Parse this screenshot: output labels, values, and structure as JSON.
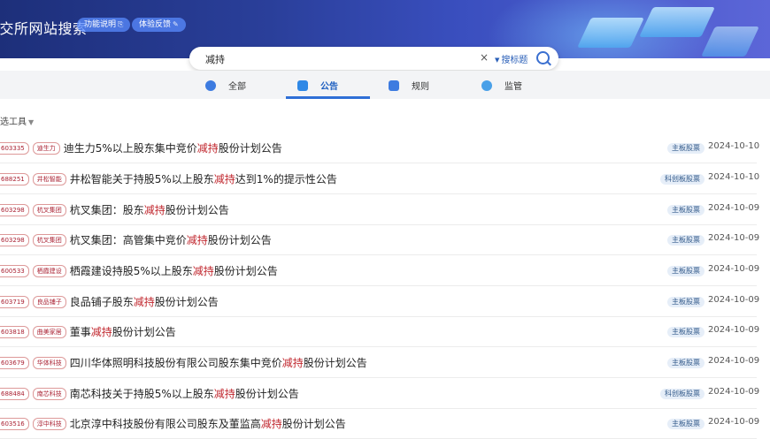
{
  "header": {
    "title": "上交所网站搜索",
    "title_visible": "上交所网站搜索",
    "pills": [
      {
        "label": "功能说明",
        "icon": "info-icon"
      },
      {
        "label": "体验反馈",
        "icon": "feedback-icon"
      }
    ]
  },
  "search": {
    "query": "减持",
    "clear": "×",
    "mode_label": "搜标题"
  },
  "tabs": [
    {
      "label": "全部",
      "icon": "all-icon",
      "active": false
    },
    {
      "label": "公告",
      "icon": "announcement-icon",
      "active": true
    },
    {
      "label": "规则",
      "icon": "rules-icon",
      "active": false
    },
    {
      "label": "监管",
      "icon": "supervision-icon",
      "active": false
    }
  ],
  "filter": {
    "label": "筛选工具"
  },
  "results": [
    {
      "code": "603335",
      "name": "迪生力",
      "pre": "迪生力5%以上股东集中竞价",
      "kw": "减持",
      "post": "股份计划公告",
      "board": "主板股票",
      "date": "2024-10-10"
    },
    {
      "code": "688251",
      "name": "井松智能",
      "pre": "井松智能关于持股5%以上股东",
      "kw": "减持",
      "post": "达到1%的提示性公告",
      "board": "科创板股票",
      "date": "2024-10-10"
    },
    {
      "code": "603298",
      "name": "杭叉集团",
      "pre": "杭叉集团：股东",
      "kw": "减持",
      "post": "股份计划公告",
      "board": "主板股票",
      "date": "2024-10-09"
    },
    {
      "code": "603298",
      "name": "杭叉集团",
      "pre": "杭叉集团：高管集中竞价",
      "kw": "减持",
      "post": "股份计划公告",
      "board": "主板股票",
      "date": "2024-10-09"
    },
    {
      "code": "600533",
      "name": "栖霞建设",
      "pre": "栖霞建设持股5%以上股东",
      "kw": "减持",
      "post": "股份计划公告",
      "board": "主板股票",
      "date": "2024-10-09"
    },
    {
      "code": "603719",
      "name": "良品铺子",
      "pre": "良品铺子股东",
      "kw": "减持",
      "post": "股份计划公告",
      "board": "主板股票",
      "date": "2024-10-09"
    },
    {
      "code": "603818",
      "name": "曲美家居",
      "pre": "董事",
      "kw": "减持",
      "post": "股份计划公告",
      "board": "主板股票",
      "date": "2024-10-09"
    },
    {
      "code": "603679",
      "name": "华体科技",
      "pre": "四川华体照明科技股份有限公司股东集中竞价",
      "kw": "减持",
      "post": "股份计划公告",
      "board": "主板股票",
      "date": "2024-10-09"
    },
    {
      "code": "688484",
      "name": "南芯科技",
      "pre": "南芯科技关于持股5%以上股东",
      "kw": "减持",
      "post": "股份计划公告",
      "board": "科创板股票",
      "date": "2024-10-09"
    },
    {
      "code": "603516",
      "name": "淳中科技",
      "pre": "北京淳中科技股份有限公司股东及董监高",
      "kw": "减持",
      "post": "股份计划公告",
      "board": "主板股票",
      "date": "2024-10-09"
    }
  ]
}
